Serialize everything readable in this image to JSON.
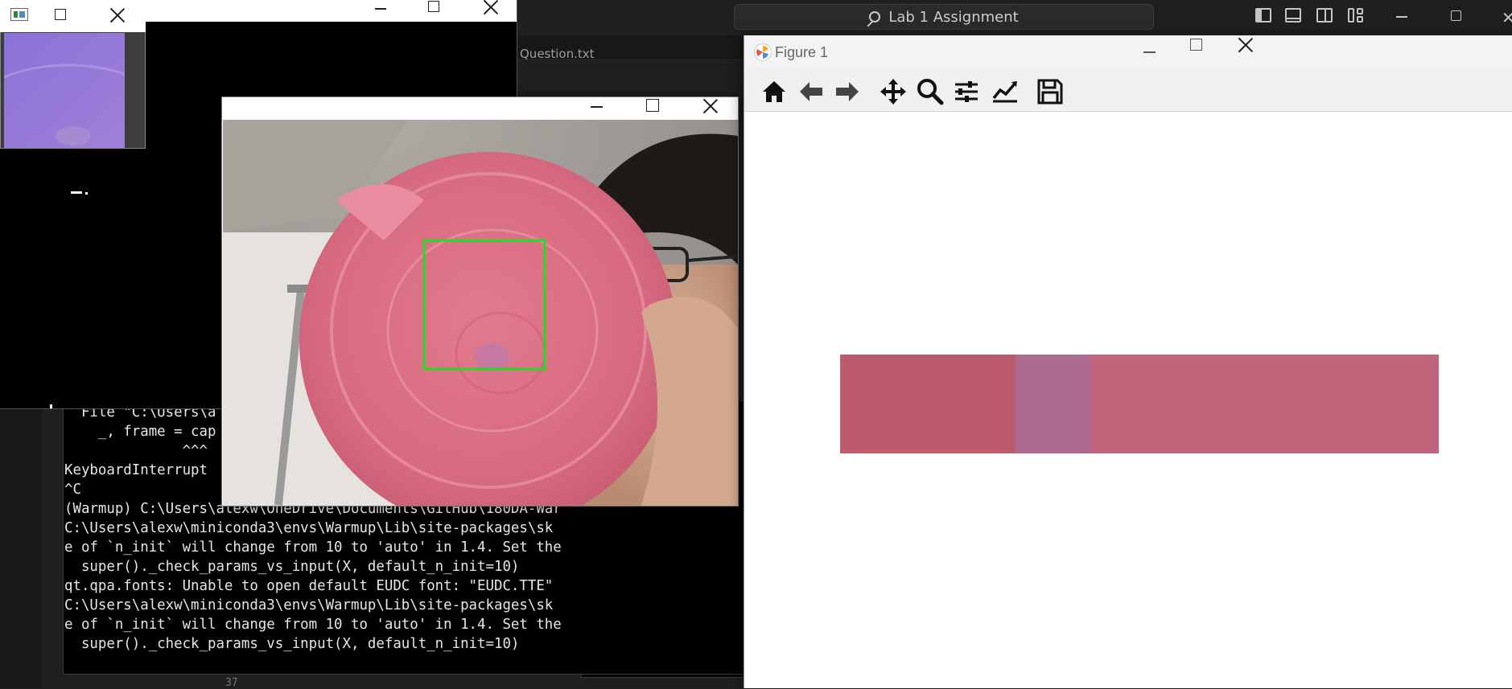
{
  "vscode": {
    "command_center": "Lab 1 Assignment",
    "tab_partial": "Question.txt",
    "line_number": "37"
  },
  "terminal": {
    "lines": [
      "  File \"C:\\Users\\a",
      "    _, frame = cap",
      "              ^^^",
      "KeyboardInterrupt",
      "^C",
      "(Warmup) C:\\Users\\alexw\\OneDrive\\Documents\\GitHub\\180DA-War",
      "C:\\Users\\alexw\\miniconda3\\envs\\Warmup\\Lib\\site-packages\\sk",
      "e of `n_init` will change from 10 to 'auto' in 1.4. Set the",
      "  super()._check_params_vs_input(X, default_n_init=10)",
      "qt.qpa.fonts: Unable to open default EUDC font: \"EUDC.TTE\"",
      "C:\\Users\\alexw\\miniconda3\\envs\\Warmup\\Lib\\site-packages\\sk",
      "e of `n_init` will change from 10 to 'auto' in 1.4. Set the",
      "  super()._check_params_vs_input(X, default_n_init=10)"
    ]
  },
  "figure": {
    "title": "Figure 1",
    "toolbar": [
      "home-icon",
      "back-arrow-icon",
      "forward-arrow-icon",
      "pan-icon",
      "zoom-icon",
      "configure-subplots-icon",
      "edit-axes-icon",
      "save-icon"
    ],
    "color_segments": [
      {
        "color": "#bc5b6c",
        "fraction": 0.293
      },
      {
        "color": "#ae6b90",
        "fraction": 0.126
      },
      {
        "color": "#c0657c",
        "fraction": 0.581
      }
    ]
  },
  "camera": {
    "roi_color": "#22dd22"
  },
  "colors": {
    "vscode_bg": "#1f1f1f",
    "terminal_bg": "#000000",
    "figure_bg": "#ffffff"
  }
}
